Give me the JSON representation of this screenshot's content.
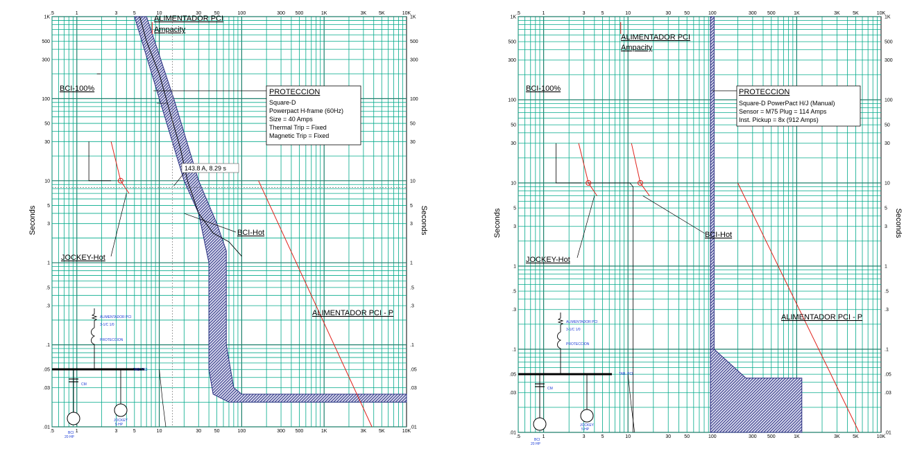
{
  "x_ticks": [
    ".5",
    "1",
    "3",
    "5",
    "10",
    "30",
    "50",
    "100",
    "300",
    "500",
    "1K",
    "3K",
    "5K",
    "10K"
  ],
  "y_ticks": [
    "1K",
    "500",
    "300",
    "100",
    "50",
    "30",
    "10",
    "5",
    "3",
    "1",
    ".5",
    ".3",
    ".1",
    ".05",
    ".03",
    ".01"
  ],
  "colors": {
    "grid": "#00a98a",
    "band": "#2a2f80",
    "red": "#e0201a",
    "oneline": "#1a3bd6"
  },
  "chart_data": [
    {
      "type": "line",
      "ylabel": "Seconds",
      "xlim": [
        0.5,
        10000
      ],
      "ylim": [
        0.01,
        1000
      ],
      "x_scale": "log",
      "y_scale": "log",
      "grid": true,
      "labels": {
        "feeder": "ALIMENTADOR PCI",
        "ampacity": "Ampacity",
        "bci100": "BCI-100%",
        "bcihot": "BCI-Hot",
        "jockey": "JOCKEY-Hot",
        "feeder_p": "ALIMENTADOR PCI - P"
      },
      "point_label": "143.8 A, 8.29 s",
      "protection_title": "PROTECCION",
      "protection_lines": [
        "Square-D",
        "Powerpact H-frame (60Hz)",
        "Size = 40 Amps",
        "Thermal Trip = Fixed",
        "Magnetic Trip = Fixed"
      ],
      "oneline": {
        "feeder": "ALIMENTADOR PCI",
        "cable": "3-1/C 1/0",
        "breaker": "PROTECCION",
        "bus": "TAB. PCI",
        "cap": "CM",
        "motor1": "BCI",
        "motor1_hp": "20 HP",
        "motor2": "JOCKEY",
        "motor2_hp": "5 HP"
      },
      "series": [
        {
          "name": "BCI-Hot",
          "x": [
            5.8,
            7,
            10,
            14,
            18,
            22,
            30,
            45,
            70,
            100
          ],
          "y": [
            1000,
            500,
            200,
            60,
            25,
            10,
            4,
            2.3,
            1.8,
            1.2
          ]
        },
        {
          "name": "JOCKEY-Hot",
          "x": [
            2.6,
            3.4,
            4.3
          ],
          "y": [
            30,
            10,
            7
          ]
        },
        {
          "name": "ALIMENTADOR PCI - P",
          "x": [
            160,
            3800
          ],
          "y": [
            10,
            0.01
          ]
        },
        {
          "name": "PROTECCION",
          "x_lower": [
            5,
            10,
            20,
            30,
            40,
            40,
            45,
            70,
            10000
          ],
          "y_lower": [
            1000,
            100,
            10,
            4,
            1,
            0.05,
            0.025,
            0.02,
            0.02
          ],
          "x_upper": [
            7,
            15,
            30,
            50,
            65,
            65,
            80,
            100,
            10000
          ],
          "y_upper": [
            1000,
            100,
            10,
            3,
            1.4,
            0.1,
            0.03,
            0.025,
            0.025
          ]
        }
      ]
    },
    {
      "type": "line",
      "ylabel": "Seconds",
      "xlim": [
        0.5,
        10000
      ],
      "ylim": [
        0.01,
        1000
      ],
      "x_scale": "log",
      "y_scale": "log",
      "grid": true,
      "labels": {
        "feeder": "ALIMENTADOR PCI",
        "ampacity": "Ampacity",
        "bci100": "BCI-100%",
        "bcihot": "BCI-Hot",
        "jockey": "JOCKEY-Hot",
        "feeder_p": "ALIMENTADOR PCI - P"
      },
      "protection_title": "PROTECCION",
      "protection_lines": [
        "Square-D  PowerPact H/J (Manual)",
        "Sensor = M75 Plug = 114 Amps",
        "Inst. Pickup = 8x (912 Amps)"
      ],
      "oneline": {
        "feeder": "ALIMENTADOR PCI",
        "cable": "3-1/C 1/0",
        "breaker": "PROTECCION",
        "bus": "TAB. PCI",
        "cap": "CM",
        "motor1": "BCI",
        "motor1_hp": "20 HP",
        "motor2": "JOCKEY",
        "motor2_hp": "5 HP"
      },
      "series": [
        {
          "name": "BCI-Hot",
          "x": [
            2.6,
            3.4,
            4.3
          ],
          "y": [
            30,
            10,
            7
          ]
        },
        {
          "name": "JOCKEY-Hot",
          "x": [
            11,
            14,
            18
          ],
          "y": [
            30,
            10,
            7
          ]
        },
        {
          "name": "ALIMENTADOR PCI - P",
          "x": [
            200,
            5500
          ],
          "y": [
            10,
            0.01
          ]
        },
        {
          "name": "PROTECCION",
          "x": [
            95,
            95,
            110,
            110,
            300,
            1150,
            1150
          ],
          "y": [
            1000,
            0.08,
            0.08,
            1000,
            0.04,
            0.04,
            0.01
          ]
        }
      ]
    }
  ]
}
